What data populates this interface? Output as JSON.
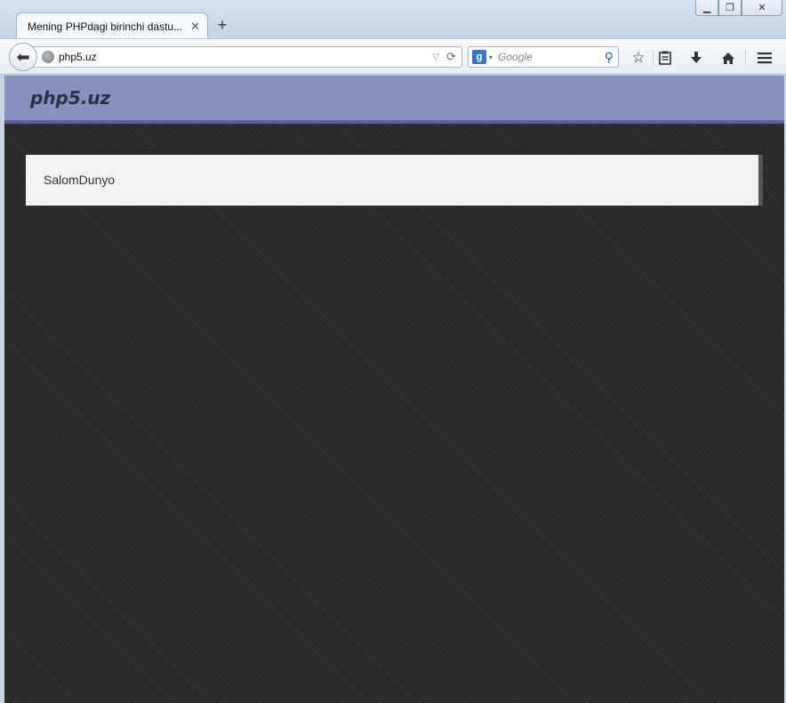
{
  "window": {
    "minimize_icon": "minimize-icon",
    "maximize_icon": "maximize-icon",
    "close_icon": "close-icon"
  },
  "tab": {
    "title": "Mening PHPdagi birinchi dastu...",
    "close_glyph": "✕"
  },
  "new_tab_glyph": "+",
  "navbar": {
    "url": "php5.uz",
    "search_engine_glyph": "g",
    "search_placeholder": "Google"
  },
  "page": {
    "site_title": "php5.uz",
    "content_text": "SalomDunyo"
  },
  "colors": {
    "header_bg": "#8891bf",
    "page_bg": "#2c2c2c",
    "box_bg": "#f2f2f2"
  }
}
